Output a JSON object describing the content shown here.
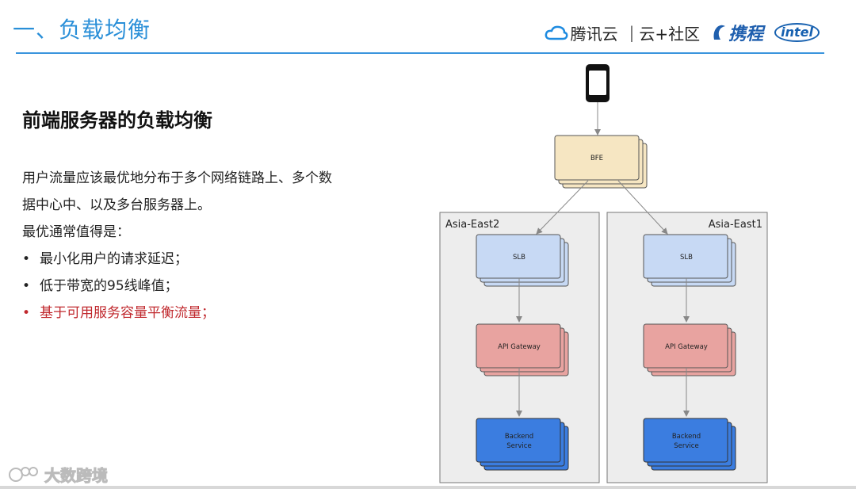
{
  "header": {
    "title": "一、负载均衡",
    "logos": {
      "tencent_text": "腾讯云",
      "separator": "|",
      "community_text": "云+社区",
      "ctrip_text": "携程",
      "intel_text": "intel"
    }
  },
  "content": {
    "heading": "前端服务器的负载均衡",
    "paragraph_line1": "用户流量应该最优地分布于多个网络链路上、多个数",
    "paragraph_line2": "据中心中、以及多台服务器上。",
    "subheading": "最优通常值得是：",
    "bullets": [
      "最小化用户的请求延迟；",
      "低于带宽的95线峰值；",
      "基于可用服务容量平衡流量；"
    ]
  },
  "diagram": {
    "client_icon": "smartphone-icon",
    "bfe_label": "BFE",
    "regions": [
      {
        "name": "Asia-East2",
        "slb": "SLB",
        "gateway": "API Gateway",
        "backend_line1": "Backend",
        "backend_line2": "Service"
      },
      {
        "name": "Asia-East1",
        "slb": "SLB",
        "gateway": "API Gateway",
        "backend_line1": "Backend",
        "backend_line2": "Service"
      }
    ],
    "colors": {
      "bfe": "#f6e6c2",
      "slb": "#c7d9f4",
      "gateway": "#e8a3a0",
      "backend": "#3b7de0",
      "region_bg": "#ededed",
      "arrow": "#888888"
    }
  },
  "watermark": {
    "text": "大数跨境"
  }
}
